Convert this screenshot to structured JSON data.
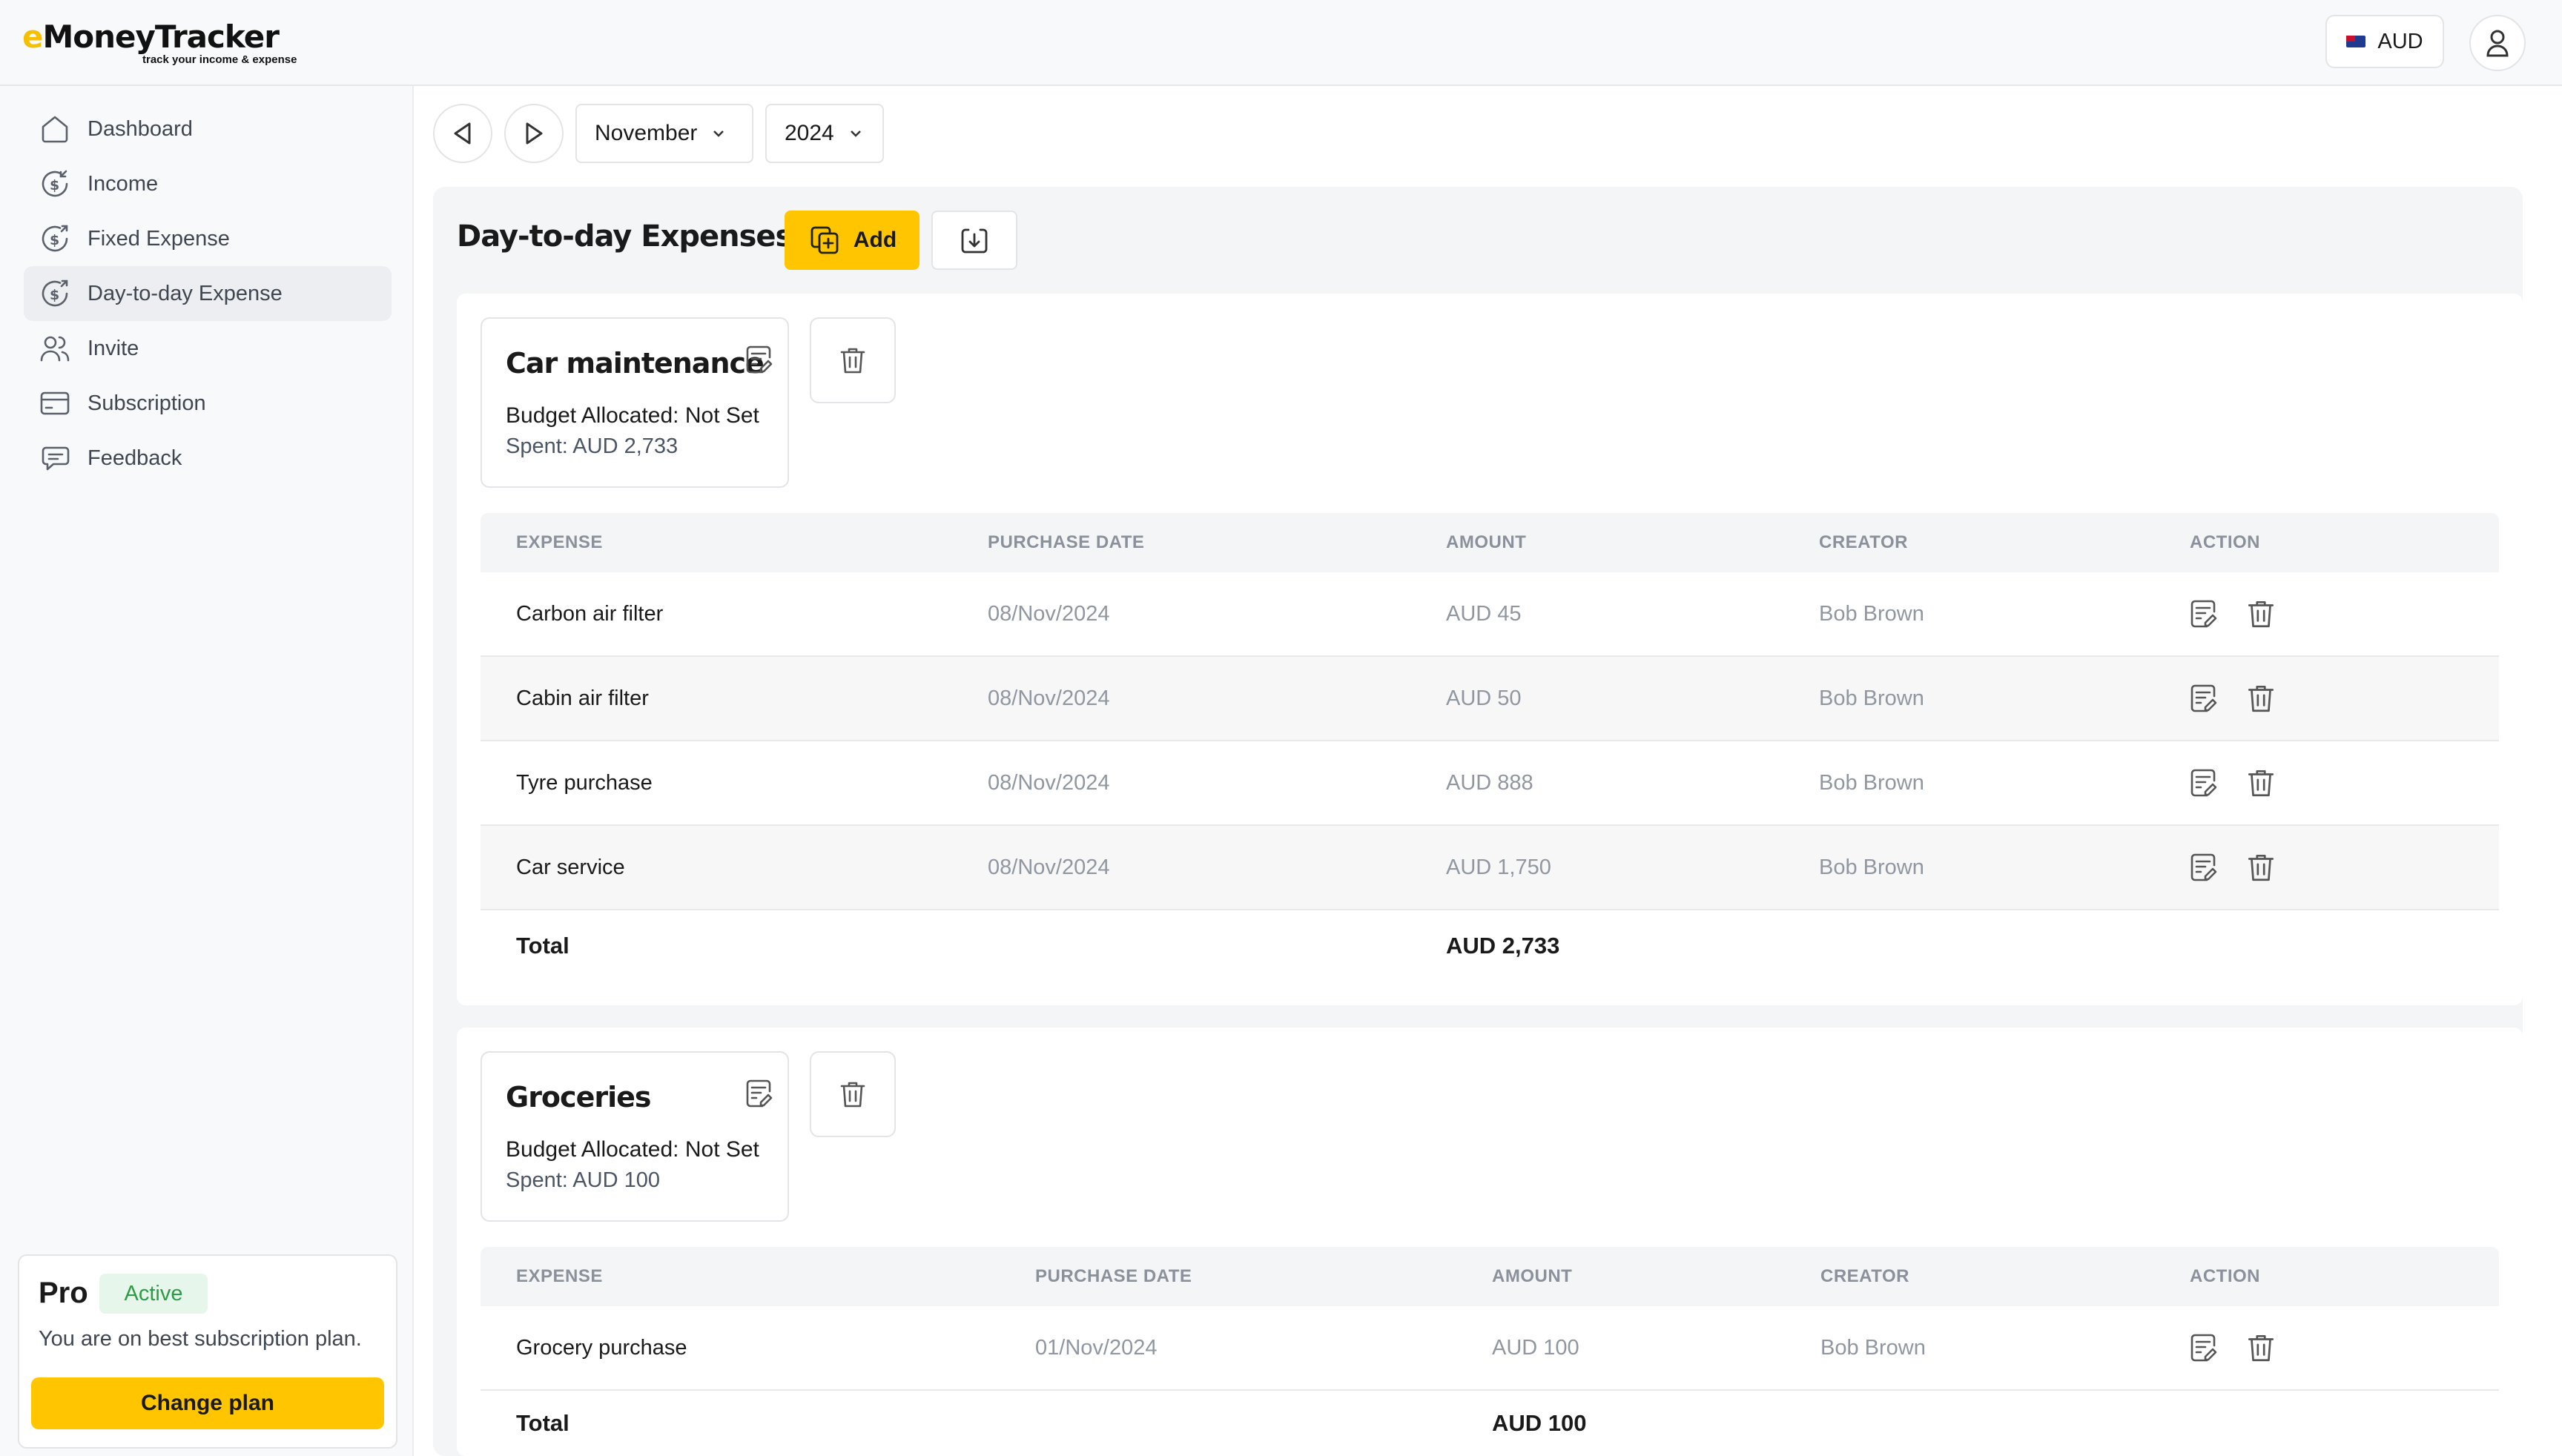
{
  "app": {
    "logo": "MoneyTracker",
    "logo_prefix": "e",
    "tagline": "track your income & expense"
  },
  "header": {
    "currency": "AUD"
  },
  "sidebar": {
    "items": [
      {
        "label": "Dashboard",
        "icon": "home-icon"
      },
      {
        "label": "Income",
        "icon": "income-icon"
      },
      {
        "label": "Fixed Expense",
        "icon": "fixed-expense-icon"
      },
      {
        "label": "Day-to-day Expense",
        "icon": "day-expense-icon",
        "active": true
      },
      {
        "label": "Invite",
        "icon": "users-icon"
      },
      {
        "label": "Subscription",
        "icon": "card-icon"
      },
      {
        "label": "Feedback",
        "icon": "chat-icon"
      }
    ],
    "plan": {
      "title": "Pro",
      "status": "Active",
      "description": "You are on best subscription plan.",
      "button": "Change plan"
    }
  },
  "controls": {
    "month": "November",
    "year": "2024"
  },
  "page": {
    "title": "Day-to-day Expenses",
    "add_label": "Add"
  },
  "columns": {
    "expense": "EXPENSE",
    "date": "PURCHASE DATE",
    "amount": "AMOUNT",
    "creator": "CREATOR",
    "action": "ACTION"
  },
  "categories": [
    {
      "name": "Car maintenance",
      "budget": "Budget Allocated: Not Set",
      "spent": "Spent: AUD 2,733",
      "rows": [
        {
          "expense": "Carbon air filter",
          "date": "08/Nov/2024",
          "amount": "AUD 45",
          "creator": "Bob Brown"
        },
        {
          "expense": "Cabin air filter",
          "date": "08/Nov/2024",
          "amount": "AUD 50",
          "creator": "Bob Brown"
        },
        {
          "expense": "Tyre purchase",
          "date": "08/Nov/2024",
          "amount": "AUD 888",
          "creator": "Bob Brown"
        },
        {
          "expense": "Car service",
          "date": "08/Nov/2024",
          "amount": "AUD 1,750",
          "creator": "Bob Brown"
        }
      ],
      "total_label": "Total",
      "total": "AUD 2,733"
    },
    {
      "name": "Groceries",
      "budget": "Budget Allocated: Not Set",
      "spent": "Spent: AUD 100",
      "rows": [
        {
          "expense": "Grocery purchase",
          "date": "01/Nov/2024",
          "amount": "AUD 100",
          "creator": "Bob Brown"
        }
      ],
      "total_label": "Total",
      "total": "AUD 100"
    }
  ],
  "colors": {
    "accent": "#ffc600",
    "active_badge_bg": "#e6f6ea",
    "active_badge_text": "#2e9a4a"
  }
}
